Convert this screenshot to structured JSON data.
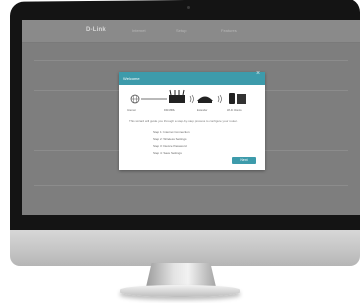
{
  "screen": {
    "brand": "D-Link",
    "nav": [
      "Internet",
      "Setup",
      "Features"
    ]
  },
  "wizard": {
    "title": "Welcome",
    "close_icon": "close-icon",
    "devices": [
      "Internet",
      "DIR-868L",
      "Extender",
      "Wi-Fi Clients"
    ],
    "description": "This wizard will guide you through a step-by-step process to configure your router.",
    "steps": [
      "Step 1: Internet Connection",
      "Step 2: Wireless Settings",
      "Step 3: Device Password",
      "Step 4: Save Settings"
    ],
    "next_label": "Next"
  },
  "colors": {
    "accent": "#3d9bab",
    "screen_overlay": "#7e7e7e",
    "bezel": "#141414"
  }
}
